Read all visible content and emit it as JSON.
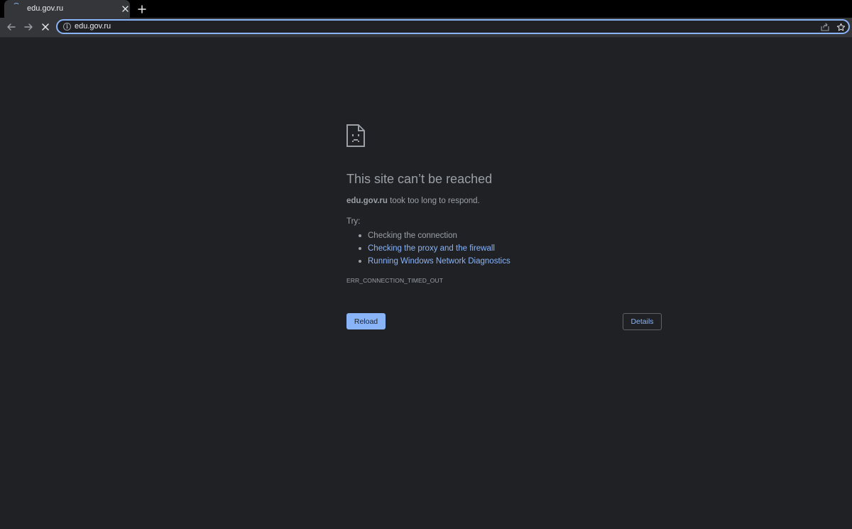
{
  "tab": {
    "title": "edu.gov.ru",
    "loading_icon": "loading-spinner-icon",
    "close_icon": "close-icon"
  },
  "new_tab_icon": "plus-icon",
  "toolbar": {
    "back_icon": "arrow-left-icon",
    "forward_icon": "arrow-right-icon",
    "stop_icon": "close-icon",
    "site_info_icon": "info-icon",
    "url": "edu.gov.ru",
    "share_icon": "share-icon",
    "bookmark_icon": "star-icon"
  },
  "error_page": {
    "icon": "sad-document-icon",
    "heading": "This site can’t be reached",
    "host": "edu.gov.ru",
    "summary_rest": " took too long to respond.",
    "try_label": "Try:",
    "suggestions": [
      {
        "text": "Checking the connection",
        "link": false
      },
      {
        "text": "Checking the proxy and the firewall",
        "link": true
      },
      {
        "text": "Running Windows Network Diagnostics",
        "link": true
      }
    ],
    "error_code": "ERR_CONNECTION_TIMED_OUT",
    "reload_label": "Reload",
    "details_label": "Details"
  },
  "colors": {
    "page_background": "#202124",
    "toolbar_background": "#35363a",
    "tabstrip_background": "#000000",
    "text_secondary": "#9aa0a6",
    "link": "#8ab4f8",
    "focus_ring": "#8ab4f8"
  }
}
